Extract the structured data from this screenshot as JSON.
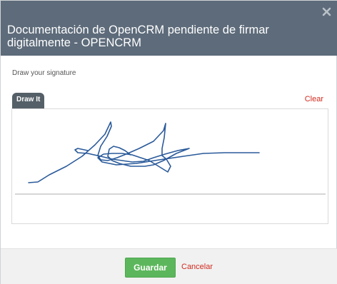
{
  "dialog": {
    "title": "Documentación de OpenCRM pendiente de firmar digitalmente - OPENCRM",
    "close_icon": "close-x-icon"
  },
  "signature": {
    "instruction": "Draw your signature",
    "tab_label": "Draw It",
    "clear_label": "Clear",
    "stroke_color": "#2a5a9a"
  },
  "footer": {
    "save_label": "Guardar",
    "cancel_label": "Cancelar"
  },
  "colors": {
    "header": "#5d6b7a",
    "accent_green": "#5cb75c",
    "link_red": "#d02a1e"
  }
}
